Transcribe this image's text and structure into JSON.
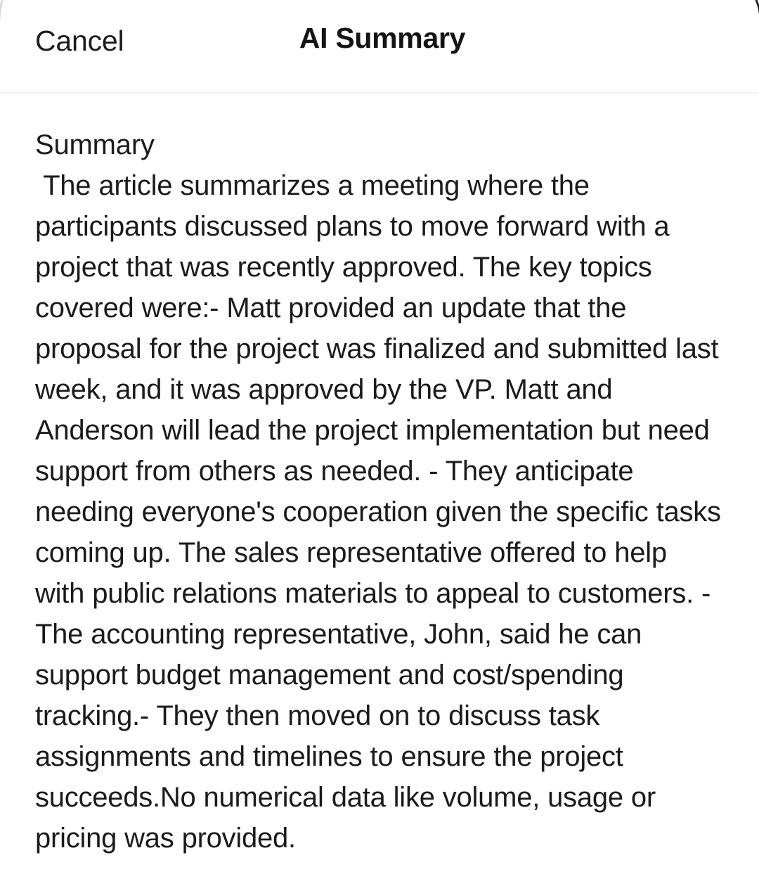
{
  "app": {
    "background_color": "#ffffff",
    "text_color": "#1b1b1b",
    "divider_color": "#f0f0f0"
  },
  "navbar": {
    "cancel_label": "Cancel",
    "title": "AI Summary"
  },
  "content": {
    "section_heading": "Summary",
    "summary_text": " The article summarizes a meeting where the participants discussed plans to move forward with a project that was recently approved. The key topics covered were:- Matt provided an update that the proposal for the project was finalized and submitted last week, and it was approved by the VP. Matt and Anderson will lead the project implementation but need support from others as needed. - They anticipate needing everyone's cooperation given the specific tasks coming up. The sales representative offered to help with public relations materials to appeal to customers. - The accounting representative, John, said he can support budget management and cost/spending tracking.- They then moved on to discuss task assignments and timelines to ensure the project succeeds.No numerical data like volume, usage or pricing was provided.",
    "lines": [
      " The article summarizes a meeting where the",
      "participants discussed plans to move forward with a",
      "project that was recently approved. The key topics",
      "covered were:- Matt provided an update that the",
      "proposal for the project was finalized and submitted",
      "last week, and it was approved by the VP. Matt and",
      "Anderson will lead the project implementation but",
      "need support from others as needed. - They",
      "anticipate needing everyone's cooperation given the",
      "specific tasks coming up. The sales representative",
      "offered to help with public relations materials to",
      "appeal to customers. - The accounting",
      "representative, John, said he can support budget",
      "management and cost/spending tracking.- They then",
      "moved on to discuss task assignments and timelines",
      "to ensure the project succeeds.No numerical data",
      "like volume, usage or pricing was provided."
    ]
  }
}
